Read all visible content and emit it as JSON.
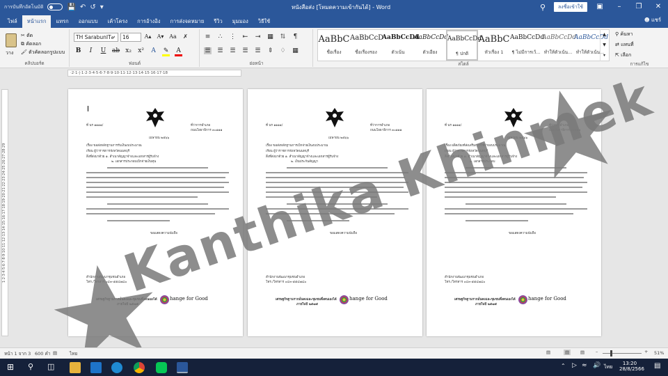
{
  "titlebar": {
    "autosave_label": "การบันทึกอัตโนมัติ",
    "title": "หนังสือส่ง [โหมดความเข้ากันได้] - Word",
    "signin_label": "ลงชื่อเข้าใช้"
  },
  "menu": {
    "tabs": [
      "ไฟล์",
      "หน้าแรก",
      "แทรก",
      "ออกแบบ",
      "เค้าโครง",
      "การอ้างอิง",
      "การส่งจดหมาย",
      "รีวิว",
      "มุมมอง",
      "วิธีใช้"
    ],
    "active_index": 1,
    "share_label": "แชร์"
  },
  "ribbon": {
    "clipboard": {
      "paste_label": "วาง",
      "cut_label": "ตัด",
      "copy_label": "คัดลอก",
      "format_painter_label": "ตัวคัดลอกรูปแบบ",
      "group_label": "คลิปบอร์ด"
    },
    "font": {
      "name": "TH SarabunIT๙",
      "size": "16",
      "group_label": "ฟอนต์"
    },
    "paragraph": {
      "group_label": "ย่อหน้า"
    },
    "styles": {
      "items": [
        {
          "preview": "AaBbC",
          "name": "ชื่อเรื่อง"
        },
        {
          "preview": "AaBbCcD",
          "name": "ชื่อเรื่องรอง"
        },
        {
          "preview": "AaBbCcDd",
          "name": "ตัวเน้น"
        },
        {
          "preview": "AaBbCcDd",
          "name": "ตัวเอียง"
        },
        {
          "preview": "AaBbCcDd",
          "name": "¶ ปกติ"
        },
        {
          "preview": "AaBbC",
          "name": "หัวเรื่อง 1"
        },
        {
          "preview": "AaBbCcDd",
          "name": "¶ ไม่มีการเว้..."
        },
        {
          "preview": "AaBbCcDd",
          "name": "ทำให้ตัวเน้น..."
        },
        {
          "preview": "AaBbCcDd",
          "name": "ทำให้ตัวเน้น..."
        }
      ],
      "selected_index": 4,
      "group_label": "สไตล์"
    },
    "editing": {
      "find_label": "ค้นหา",
      "replace_label": "แทนที่",
      "select_label": "เลือก",
      "group_label": "การแก้ไข"
    }
  },
  "ruler": {
    "h_text": "·2·1·|·1·2·3·4·5·6·7·8·9·10·11·12·13·14·15·16·17·18"
  },
  "pages": [
    {
      "doc_no": "ที่ นร ๑๑๑๑/",
      "office": [
        "ที่ว่าการอำเภอ",
        "ถนนโยธาธิการ ๓๐๑๑๑"
      ],
      "date": "เมษายน ๒๕๖๖",
      "subject": "เรื่อง ขอส่งหลักฐานการรับเงินงบประมาณ",
      "to": "เรียน ผู้ว่าราชการจังหวัดนนทบุรี",
      "attach": [
        "สิ่งที่ส่งมาด้วย ๑. สำเนาสัญญาจ้างและเอกสารผู้รับจ้าง",
        "๒. เอกสารประกอบเบิกจ่ายเงินทุน"
      ],
      "sign": "ขอแสดงความนับถือ",
      "footer": [
        "สำนักงานพัฒนาชุมชนอำเภอ",
        "โทร./โทรสาร ๐๔๓-๕๕๔๗๘๐"
      ],
      "slogan": [
        "เศรษฐกิจฐานรากมั่นคงและชุมชนพึ่งตนเองได้",
        "ภายในปี ๒๕๗๕"
      ],
      "cfg_text": "hange for Good"
    },
    {
      "doc_no": "ที่ นร ๑๑๑๑/",
      "office": [
        "ที่ว่าการอำเภอ",
        "ถนนโยธาธิการ ๓๐๑๑๑"
      ],
      "date": "เมษายน ๒๕๖๖",
      "subject": "เรื่อง ขอส่งหลักฐานการเบิกจ่ายเงินงบประมาณ",
      "to": "เรียน ผู้ว่าราชการจังหวัดนนทบุรี",
      "attach": [
        "สิ่งที่ส่งมาด้วย ๑. สำเนาสัญญาจ้างและเอกสารผู้รับจ้าง",
        "๒. เงินประกันสัญญา"
      ],
      "sign": "ขอแสดงความนับถือ",
      "footer": [
        "สำนักงานพัฒนาชุมชนอำเภอ",
        "โทร./โทรสาร ๐๔๓-๕๕๔๗๘๐"
      ],
      "slogan": [
        "เศรษฐกิจฐานรากมั่นคงและชุมชนพึ่งตนเองได้",
        "ภายในปี ๒๕๗๕"
      ],
      "cfg_text": "hange for Good"
    },
    {
      "doc_no": "ที่ นร ๑๑๑๑/",
      "office": [
        "ที่ว่าการอำเภอ",
        "ถนนโยธาธิการ ๓๐๑๑๑"
      ],
      "date": "เมษายน ๒๕๖๖",
      "subject": "เรื่อง ผลิตภัณฑ์ส่งเสริมการใช้จ่ายงบประมาณ",
      "to": "เรียน ผู้ว่าราชการจังหวัดนนทบุรี",
      "attach": [
        "สิ่งที่ส่งมาด้วย ๑. สำเนาสัญญาจ้างและเอกสารผู้รับจ้าง",
        "๒. เอกสารประกอบ"
      ],
      "sign": "ขอแสดงความนับถือ",
      "footer": [
        "สำนักงานพัฒนาชุมชนอำเภอ",
        "โทร./โทรสาร ๐๔๓-๕๕๔๗๘๐"
      ],
      "slogan": [
        "เศรษฐกิจฐานรากมั่นคงและชุมชนพึ่งตนเองได้",
        "ภายในปี ๒๕๗๕"
      ],
      "cfg_text": "hange for Good"
    }
  ],
  "watermark": {
    "text": "Kanthika Khinmek"
  },
  "statusbar": {
    "page": "หน้า 1 จาก 3",
    "words": "600 คำ",
    "language": "ไทย",
    "zoom": "51%"
  },
  "taskbar": {
    "time": "13:20",
    "date": "28/8/2566",
    "lang": "ไทย"
  },
  "colors": {
    "accent": "#2b579a",
    "taskbar": "#15213a",
    "watermark": "#7a7a7a"
  }
}
